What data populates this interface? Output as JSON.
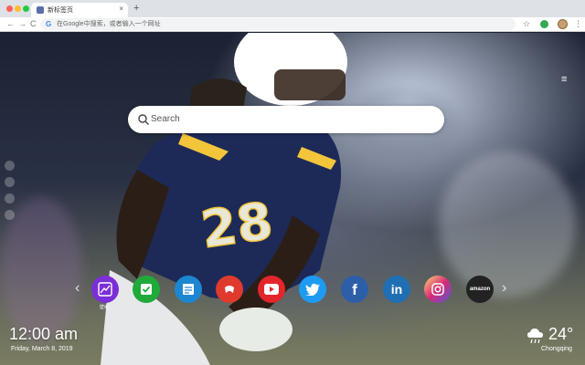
{
  "browser": {
    "tab_title": "新标签页",
    "tab_close": "×",
    "new_tab": "+",
    "back": "←",
    "forward": "→",
    "reload": "C",
    "omnibox_g": "G",
    "omnibox_placeholder": "在Google中搜索，或者输入一个网址",
    "star": "☆",
    "menu": "⋮"
  },
  "page": {
    "menu_icon": "≡",
    "search_placeholder": "Search",
    "shortcuts": [
      {
        "name": "photo-editor",
        "color": "#7b2fd6"
      },
      {
        "name": "checklist",
        "color": "#1faa3a"
      },
      {
        "name": "notes",
        "color": "#1c86d1"
      },
      {
        "name": "gamepad",
        "color": "#e03a2f"
      },
      {
        "name": "youtube",
        "color": "#e3262b"
      },
      {
        "name": "twitter",
        "color": "#1d9bf0"
      },
      {
        "name": "facebook",
        "color": "#2d5fa8"
      },
      {
        "name": "linkedin",
        "color": "#1f6fb2"
      },
      {
        "name": "instagram",
        "color": "#d62976"
      },
      {
        "name": "amazon",
        "color": "#222222"
      }
    ],
    "shortcut_label": "壁纸",
    "amazon_text": "amazon",
    "linkedin_text": "in",
    "facebook_text": "f",
    "arrow_left": "‹",
    "arrow_right": "›",
    "clock": "12:00 am",
    "date": "Friday, March 8, 2019",
    "temperature": "24°",
    "city": "Chongqing"
  }
}
